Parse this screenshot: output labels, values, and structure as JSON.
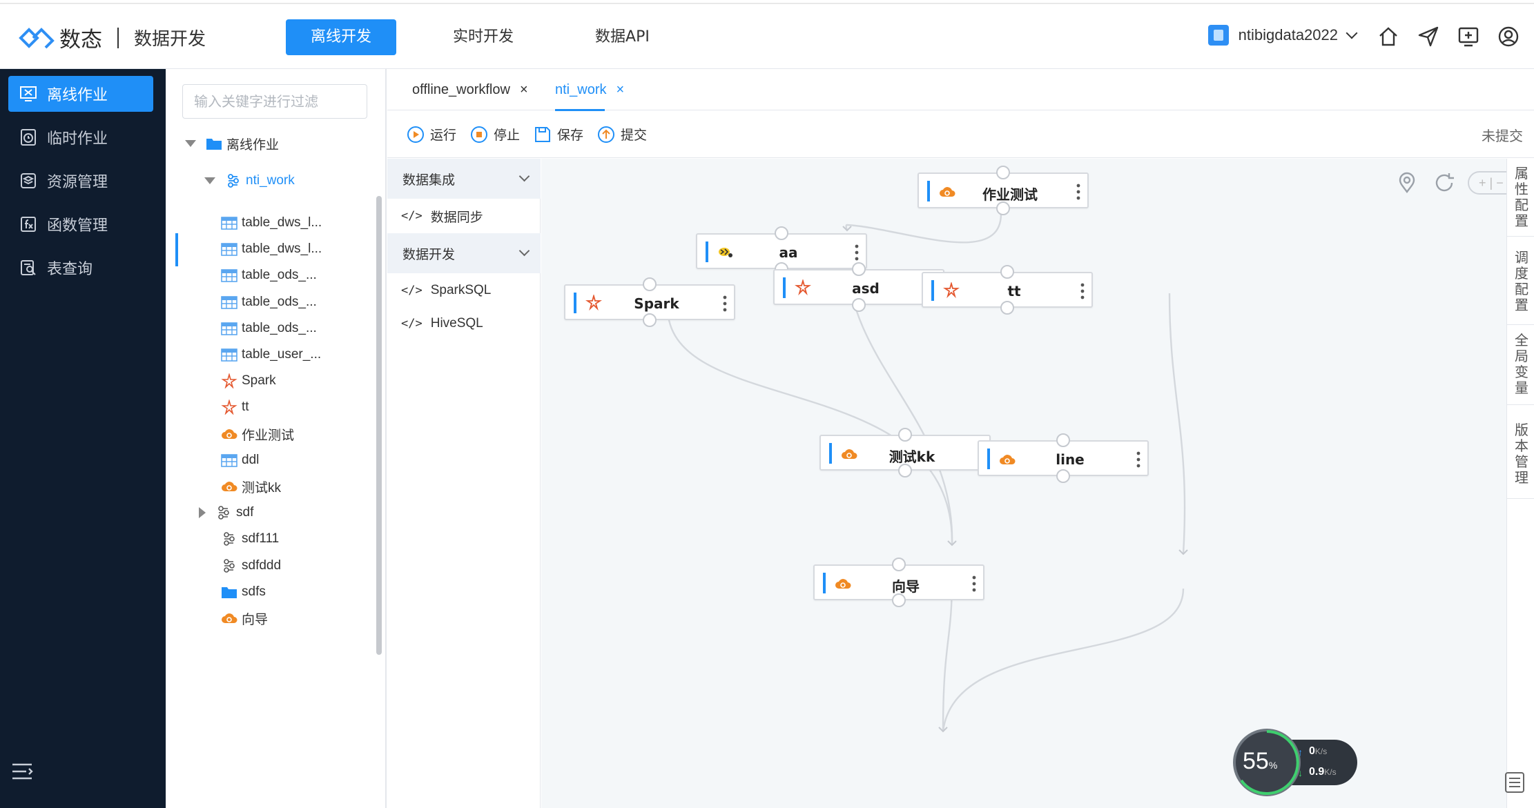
{
  "header": {
    "logo_text": "数态",
    "subtitle": "数据开发",
    "nav": [
      "离线开发",
      "实时开发",
      "数据API"
    ],
    "active_nav": 0,
    "project": "ntibigdata2022"
  },
  "sidebar": {
    "items": [
      {
        "label": "离线作业",
        "icon": "monitor-icon",
        "active": true
      },
      {
        "label": "临时作业",
        "icon": "timer-icon",
        "active": false
      },
      {
        "label": "资源管理",
        "icon": "layers-icon",
        "active": false
      },
      {
        "label": "函数管理",
        "icon": "function-icon",
        "active": false
      },
      {
        "label": "表查询",
        "icon": "table-search-icon",
        "active": false
      }
    ]
  },
  "tree": {
    "filter_placeholder": "输入关键字进行过滤",
    "root": "离线作业",
    "workflow": "nti_work",
    "children": [
      {
        "label": "table_dws_l...",
        "icon": "table-icon"
      },
      {
        "label": "table_dws_l...",
        "icon": "table-icon"
      },
      {
        "label": "table_ods_...",
        "icon": "table-icon"
      },
      {
        "label": "table_ods_...",
        "icon": "table-icon"
      },
      {
        "label": "table_ods_...",
        "icon": "table-icon"
      },
      {
        "label": "table_user_...",
        "icon": "table-icon"
      },
      {
        "label": "Spark",
        "icon": "spark-icon"
      },
      {
        "label": "tt",
        "icon": "spark-icon"
      },
      {
        "label": "作业测试",
        "icon": "cloud-icon"
      },
      {
        "label": "ddl",
        "icon": "table-icon"
      },
      {
        "label": "测试kk",
        "icon": "cloud-icon"
      },
      {
        "label": "sdf",
        "icon": "workflow-icon"
      },
      {
        "label": "sdf111",
        "icon": "workflow-icon"
      },
      {
        "label": "sdfddd",
        "icon": "workflow-icon"
      },
      {
        "label": "sdfs",
        "icon": "folder-icon"
      },
      {
        "label": "向导",
        "icon": "cloud-icon"
      }
    ]
  },
  "tabs": [
    {
      "label": "offline_workflow",
      "close": "×",
      "active": false
    },
    {
      "label": "nti_work",
      "close": "×",
      "active": true
    }
  ],
  "toolbar": {
    "run": "运行",
    "stop": "停止",
    "save": "保存",
    "submit": "提交",
    "status": "未提交"
  },
  "palette": {
    "groups": [
      {
        "label": "数据集成",
        "items": [
          "数据同步"
        ]
      },
      {
        "label": "数据开发",
        "items": [
          "SparkSQL",
          "HiveSQL"
        ]
      }
    ],
    "code_glyph": "</>"
  },
  "canvas": {
    "nodes": [
      {
        "id": "n1",
        "label": "作业测试",
        "icon": "cloud-icon"
      },
      {
        "id": "n2",
        "label": "aa",
        "icon": "hive-icon"
      },
      {
        "id": "n3",
        "label": "asd",
        "icon": "spark-icon"
      },
      {
        "id": "n4",
        "label": "tt",
        "icon": "spark-icon"
      },
      {
        "id": "n5",
        "label": "Spark",
        "icon": "spark-icon"
      },
      {
        "id": "n6",
        "label": "测试kk",
        "icon": "cloud-icon"
      },
      {
        "id": "n7",
        "label": "line",
        "icon": "cloud-icon"
      },
      {
        "id": "n8",
        "label": "向导",
        "icon": "cloud-icon"
      }
    ],
    "zoom_controls": "+ | −"
  },
  "right_tabs": [
    "属性配置",
    "调度配置",
    "全局变量",
    "版本管理"
  ],
  "speed_widget": {
    "percent": "55",
    "percent_unit": "%",
    "up": "0",
    "down": "0.9",
    "unit": "K/s"
  },
  "colors": {
    "accent": "#1f8ff7",
    "sidebar_bg": "#0f1c2e",
    "canvas_bg": "#f4f7f9",
    "cloud_orange": "#f08a24",
    "spark_red": "#e4572e"
  }
}
